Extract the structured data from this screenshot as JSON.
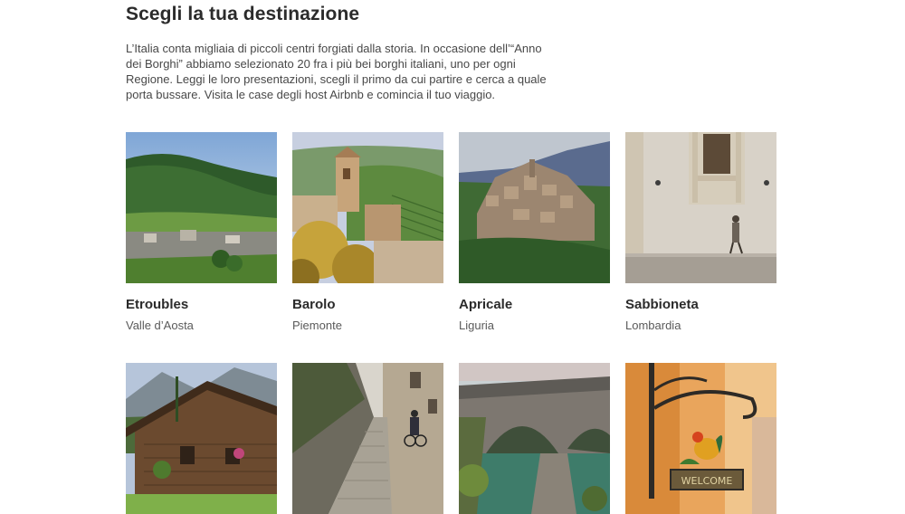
{
  "header": {
    "title": "Scegli la tua destinazione",
    "intro": "L’Italia conta migliaia di piccoli centri forgiati dalla storia. In occasione dell’“Anno dei Borghi” abbiamo selezionato 20 fra i più bei borghi italiani, uno per ogni Regione. Leggi le loro presentazioni, scegli il primo da cui partire e cerca a quale porta bussare. Visita le case degli host Airbnb e comincia il tuo viaggio."
  },
  "destinations": [
    {
      "name": "Etroubles",
      "region": "Valle d’Aosta",
      "photo": "alpine-valley-photo"
    },
    {
      "name": "Barolo",
      "region": "Piemonte",
      "photo": "vineyard-bell-tower-photo"
    },
    {
      "name": "Apricale",
      "region": "Liguria",
      "photo": "hilltop-village-photo"
    },
    {
      "name": "Sabbioneta",
      "region": "Lombardia",
      "photo": "old-wall-walker-photo"
    },
    {
      "name": "",
      "region": "",
      "photo": "wooden-chalet-photo"
    },
    {
      "name": "",
      "region": "",
      "photo": "stone-alley-photo"
    },
    {
      "name": "",
      "region": "",
      "photo": "stone-bridge-river-photo"
    },
    {
      "name": "",
      "region": "",
      "photo": "welcome-sign-rooster-photo"
    }
  ]
}
